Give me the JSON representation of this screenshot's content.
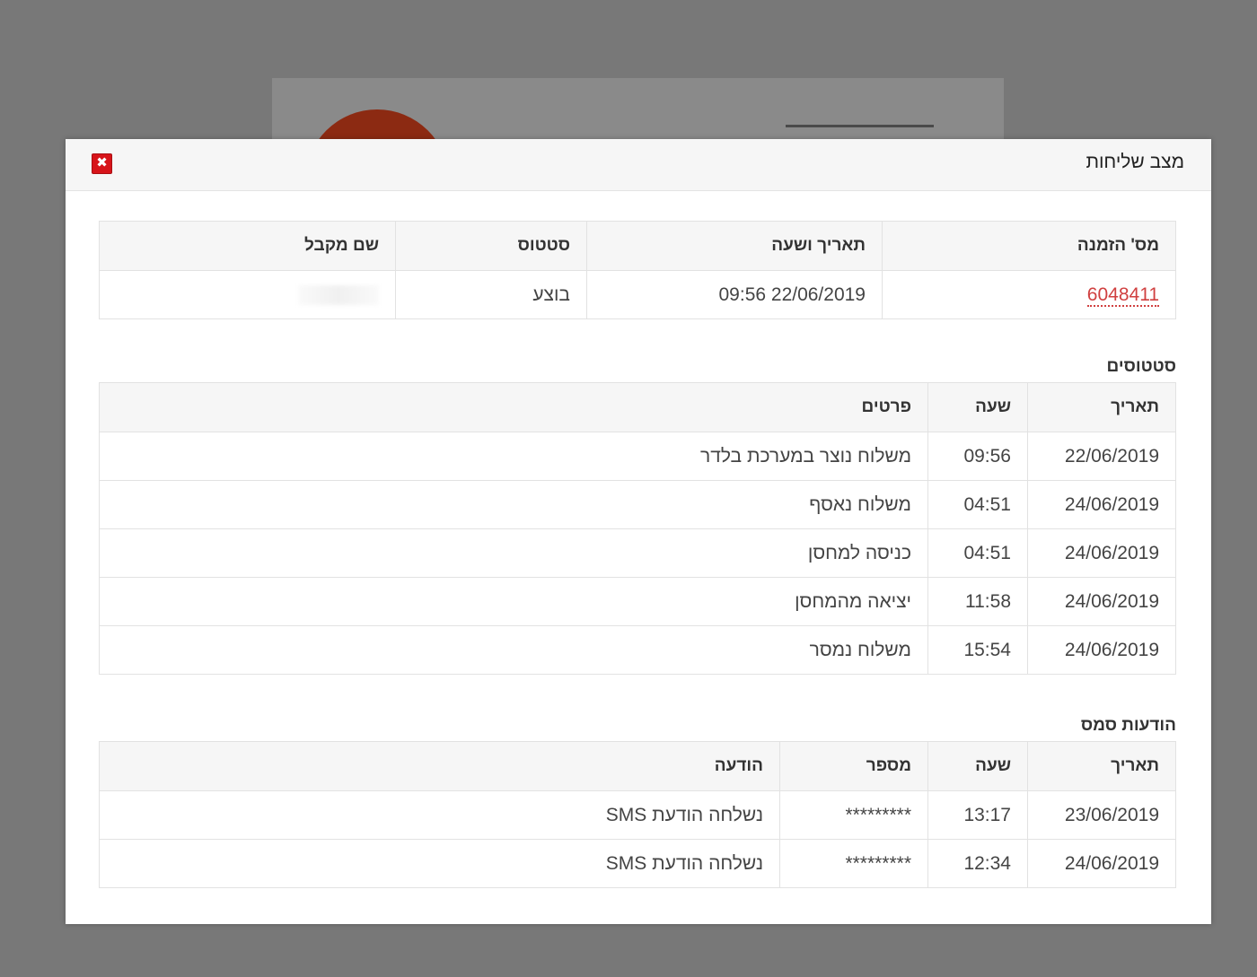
{
  "modal": {
    "title": "מצב שליחות",
    "close_label": "✖"
  },
  "order": {
    "headers": [
      "מס' הזמנה",
      "תאריך ושעה",
      "סטטוס",
      "שם מקבל"
    ],
    "order_number": "6048411",
    "datetime": "09:56 22/06/2019",
    "status": "בוצע",
    "recipient": ""
  },
  "statuses": {
    "title": "סטטוסים",
    "headers": [
      "תאריך",
      "שעה",
      "פרטים"
    ],
    "rows": [
      [
        "22/06/2019",
        "09:56",
        "משלוח נוצר במערכת בלדר"
      ],
      [
        "24/06/2019",
        "04:51",
        "משלוח נאסף"
      ],
      [
        "24/06/2019",
        "04:51",
        "כניסה למחסן"
      ],
      [
        "24/06/2019",
        "11:58",
        "יציאה מהמחסן"
      ],
      [
        "24/06/2019",
        "15:54",
        "משלוח נמסר"
      ]
    ]
  },
  "sms": {
    "title": "הודעות סמס",
    "headers": [
      "תאריך",
      "שעה",
      "מספר",
      "הודעה"
    ],
    "rows": [
      [
        "23/06/2019",
        "13:17",
        "*********",
        "נשלחה הודעת SMS"
      ],
      [
        "24/06/2019",
        "12:34",
        "*********",
        "נשלחה הודעת SMS"
      ]
    ]
  }
}
